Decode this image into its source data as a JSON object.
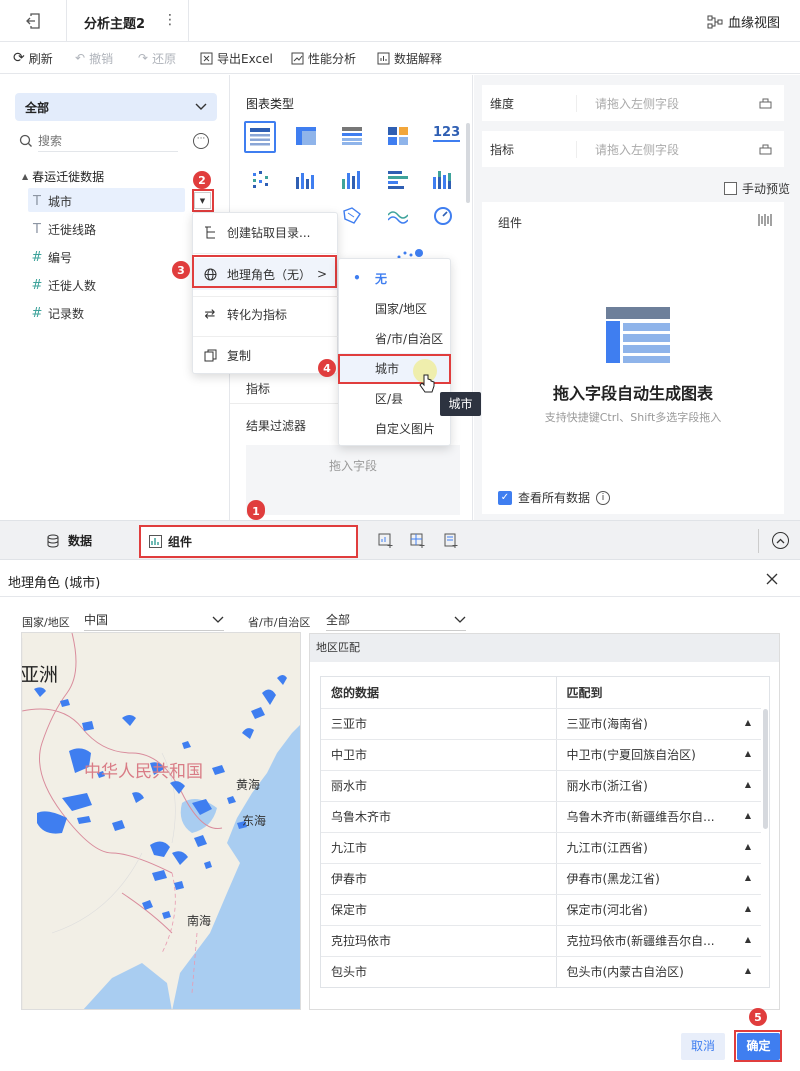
{
  "topbar": {
    "title": "分析主题2",
    "lineage_label": "血缘视图"
  },
  "toolbar": {
    "refresh": "刷新",
    "undo": "撤销",
    "redo": "还原",
    "export": "导出Excel",
    "perf": "性能分析",
    "explain": "数据解释"
  },
  "left": {
    "scope": "全部",
    "search_placeholder": "搜索",
    "dataset": "春运迁徙数据",
    "fields": [
      {
        "label": "城市",
        "type": "T"
      },
      {
        "label": "迁徙线路",
        "type": "T"
      },
      {
        "label": "编号",
        "type": "#"
      },
      {
        "label": "迁徙人数",
        "type": "#"
      },
      {
        "label": "记录数",
        "type": "#"
      }
    ]
  },
  "mid": {
    "chart_type_title": "图表类型",
    "indicator_label": "指标",
    "filter_label": "结果过滤器",
    "drop_hint": "拖入字段"
  },
  "right": {
    "dimension_label": "维度",
    "dimension_placeholder": "请拖入左侧字段",
    "metric_label": "指标",
    "metric_placeholder": "请拖入左侧字段",
    "manual_preview": "手动预览",
    "component_label": "组件",
    "empty_title": "拖入字段自动生成图表",
    "empty_hint": "支持快捷键Ctrl、Shift多选字段拖入",
    "show_all_data": "查看所有数据"
  },
  "context_menu": {
    "items": [
      "创建钻取目录...",
      "地理角色（无）",
      "转化为指标",
      "复制"
    ]
  },
  "geo_submenu": {
    "items": [
      "无",
      "国家/地区",
      "省/市/自治区",
      "城市",
      "区/县",
      "自定义图片"
    ],
    "selected": "无",
    "hovered": "城市"
  },
  "tooltip": "城市",
  "badges": [
    "1",
    "2",
    "3",
    "4",
    "5"
  ],
  "bottom_tabs": {
    "data": "数据",
    "component": "组件"
  },
  "dialog": {
    "title": "地理角色 (城市)",
    "country_label": "国家/地区",
    "country_value": "中国",
    "province_label": "省/市/自治区",
    "province_value": "全部",
    "region_match": "地区匹配",
    "table_headers": [
      "您的数据",
      "匹配到"
    ],
    "rows": [
      [
        "三亚市",
        "三亚市(海南省)"
      ],
      [
        "中卫市",
        "中卫市(宁夏回族自治区)"
      ],
      [
        "丽水市",
        "丽水市(浙江省)"
      ],
      [
        "乌鲁木齐市",
        "乌鲁木齐市(新疆维吾尔自..."
      ],
      [
        "九江市",
        "九江市(江西省)"
      ],
      [
        "伊春市",
        "伊春市(黑龙江省)"
      ],
      [
        "保定市",
        "保定市(河北省)"
      ],
      [
        "克拉玛依市",
        "克拉玛依市(新疆维吾尔自..."
      ],
      [
        "包头市",
        "包头市(内蒙古自治区)"
      ]
    ],
    "map_labels": {
      "asia": "亚洲",
      "prc": "中华人民共和国",
      "yellow_sea": "黄海",
      "east_sea": "东海",
      "south_sea": "南海"
    },
    "cancel": "取消",
    "confirm": "确定"
  },
  "colors": {
    "accent": "#3f7ef0",
    "badge": "#e03d3d",
    "map_water": "#a9cdf1",
    "map_land": "#f2efe6"
  }
}
